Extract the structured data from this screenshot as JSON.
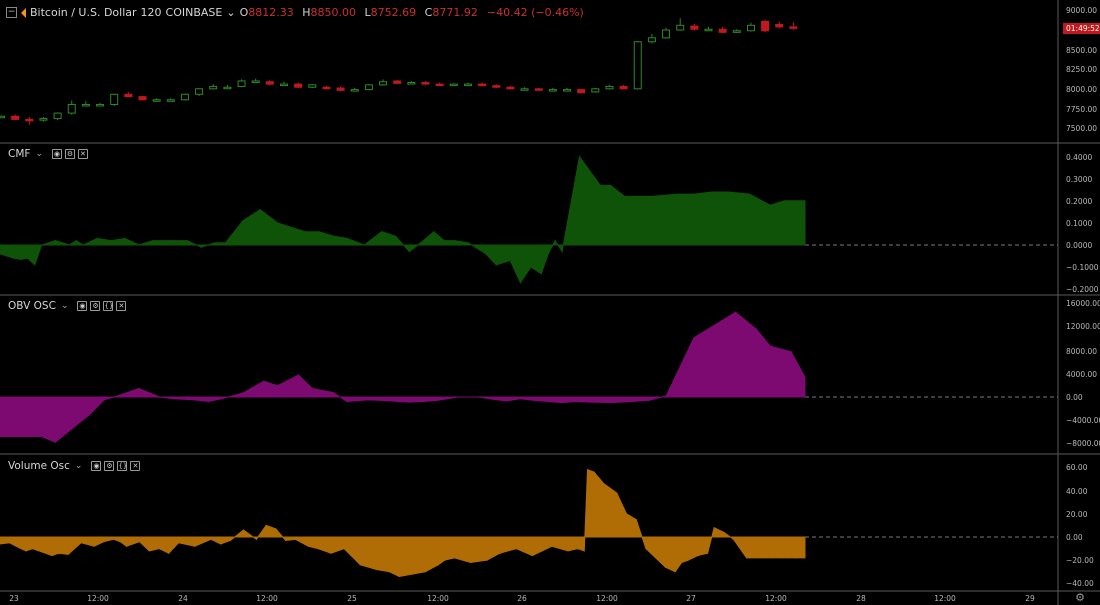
{
  "header": {
    "symbol": "Bitcoin / U.S. Dollar",
    "interval": "120",
    "exchange": "COINBASE",
    "o_label": "O",
    "o": "8812.33",
    "h_label": "H",
    "h": "8850.00",
    "l_label": "L",
    "l": "8752.69",
    "c_label": "C",
    "c": "8771.92",
    "change": "−40.42 (−0.46%)",
    "collapse_glyph": "−",
    "chevron": "⌄"
  },
  "colors": {
    "up": "#2d8a25",
    "down": "#c0181c",
    "cmf": "#0f5308",
    "obv": "#7d0a70",
    "vol": "#b06d05",
    "price_tag": "#c0181c"
  },
  "price_tag": "01:49:52",
  "x_ticks": [
    "23",
    "12:00",
    "24",
    "12:00",
    "25",
    "12:00",
    "26",
    "12:00",
    "27",
    "12:00",
    "28",
    "12:00",
    "29"
  ],
  "panes": {
    "price": {
      "ticks": [
        "9000.00",
        "8750.00",
        "8500.00",
        "8250.00",
        "8000.00",
        "7750.00",
        "7500.00"
      ]
    },
    "cmf": {
      "label": "CMF",
      "ticks": [
        "0.4000",
        "0.3000",
        "0.2000",
        "0.1000",
        "0.0000",
        "−0.1000",
        "−0.2000"
      ]
    },
    "obv": {
      "label": "OBV OSC",
      "ticks": [
        "16000.00",
        "12000.00",
        "8000.00",
        "4000.00",
        "0.00",
        "−4000.00",
        "−8000.00"
      ]
    },
    "vol": {
      "label": "Volume Osc",
      "ticks": [
        "60.00",
        "40.00",
        "20.00",
        "0.00",
        "−20.00",
        "−40.00"
      ]
    }
  },
  "chart_data": [
    {
      "type": "candlestick",
      "title": "Bitcoin / U.S. Dollar · 120 · COINBASE",
      "ylim": [
        7400,
        9100
      ],
      "x": [
        "23 00:00",
        "23 02:00",
        "23 04:00",
        "23 06:00",
        "23 08:00",
        "23 10:00",
        "23 12:00",
        "23 14:00",
        "23 16:00",
        "23 18:00",
        "23 20:00",
        "23 22:00",
        "24 00:00",
        "24 02:00",
        "24 04:00",
        "24 06:00",
        "24 08:00",
        "24 10:00",
        "24 12:00",
        "24 14:00",
        "24 16:00",
        "24 18:00",
        "24 20:00",
        "24 22:00",
        "25 00:00",
        "25 02:00",
        "25 04:00",
        "25 06:00",
        "25 08:00",
        "25 10:00",
        "25 12:00",
        "25 14:00",
        "25 16:00",
        "25 18:00",
        "25 20:00",
        "25 22:00",
        "26 00:00",
        "26 02:00",
        "26 04:00",
        "26 06:00",
        "26 08:00",
        "26 10:00",
        "26 12:00",
        "26 14:00",
        "26 16:00",
        "26 18:00",
        "26 20:00",
        "26 22:00",
        "27 00:00",
        "27 02:00",
        "27 04:00",
        "27 06:00",
        "27 08:00",
        "27 10:00",
        "27 12:00",
        "27 14:00",
        "27 16:00"
      ],
      "open": [
        7650,
        7650,
        7610,
        7600,
        7620,
        7690,
        7800,
        7800,
        7800,
        7930,
        7900,
        7860,
        7860,
        7860,
        7930,
        8000,
        8020,
        8030,
        8100,
        8090,
        8060,
        8060,
        8020,
        8020,
        8010,
        7980,
        7990,
        8050,
        8100,
        8070,
        8080,
        8060,
        8050,
        8060,
        8060,
        8040,
        8020,
        8000,
        8000,
        7990,
        7990,
        7990,
        7960,
        8000,
        8030,
        8000,
        8600,
        8650,
        8750,
        8800,
        8750,
        8760,
        8720,
        8740,
        8860,
        8820,
        8790
      ],
      "close": [
        7650,
        7610,
        7600,
        7620,
        7690,
        7800,
        7800,
        7800,
        7930,
        7900,
        7860,
        7860,
        7860,
        7930,
        8000,
        8030,
        8020,
        8100,
        8100,
        8060,
        8060,
        8020,
        8050,
        8010,
        7980,
        7990,
        8050,
        8090,
        8070,
        8080,
        8060,
        8050,
        8060,
        8060,
        8040,
        8020,
        8000,
        8000,
        7990,
        7990,
        7990,
        7950,
        8000,
        8030,
        8000,
        8600,
        8650,
        8750,
        8810,
        8760,
        8760,
        8720,
        8740,
        8810,
        8740,
        8790,
        8772
      ],
      "high": [
        7660,
        7670,
        7640,
        7640,
        7700,
        7850,
        7840,
        7820,
        7940,
        7960,
        7910,
        7880,
        7880,
        7940,
        8010,
        8060,
        8050,
        8120,
        8130,
        8110,
        8090,
        8080,
        8060,
        8040,
        8030,
        8010,
        8060,
        8120,
        8110,
        8100,
        8100,
        8080,
        8070,
        8080,
        8080,
        8060,
        8040,
        8020,
        8010,
        8010,
        8010,
        8000,
        8010,
        8050,
        8050,
        8610,
        8700,
        8780,
        8900,
        8830,
        8790,
        8790,
        8760,
        8840,
        8880,
        8860,
        8850
      ],
      "low": [
        7640,
        7600,
        7540,
        7580,
        7600,
        7670,
        7780,
        7780,
        7780,
        7890,
        7850,
        7840,
        7840,
        7850,
        7910,
        7990,
        8000,
        8020,
        8080,
        8040,
        8040,
        8010,
        8010,
        8000,
        7970,
        7970,
        7980,
        8040,
        8060,
        8060,
        8050,
        8040,
        8040,
        8050,
        8030,
        8010,
        7990,
        7990,
        7980,
        7980,
        7970,
        7940,
        7950,
        7990,
        7990,
        7990,
        8580,
        8640,
        8740,
        8740,
        8740,
        8710,
        8710,
        8730,
        8720,
        8770,
        8752
      ]
    },
    {
      "type": "area",
      "title": "CMF",
      "ylim": [
        -0.22,
        0.43
      ],
      "x": [
        0,
        4,
        6,
        8,
        10,
        12,
        16,
        20,
        22,
        24,
        28,
        32,
        36,
        40,
        44,
        50,
        54,
        58,
        62,
        65,
        70,
        75,
        80,
        84,
        88,
        92,
        96,
        100,
        105,
        110,
        114,
        118,
        122,
        125,
        128,
        131,
        135,
        140,
        143,
        147,
        150,
        153,
        156,
        158,
        160,
        162,
        167,
        173,
        176,
        180,
        188,
        195,
        200,
        205,
        210,
        216,
        222,
        226,
        230,
        232
      ],
      "values": [
        -0.04,
        -0.06,
        -0.065,
        -0.06,
        -0.09,
        0.0,
        0.02,
        0.0,
        0.02,
        0.0,
        0.03,
        0.02,
        0.03,
        0.0,
        0.02,
        0.02,
        0.02,
        -0.01,
        0.01,
        0.01,
        0.11,
        0.16,
        0.1,
        0.08,
        0.06,
        0.06,
        0.04,
        0.03,
        0.0,
        0.06,
        0.04,
        -0.03,
        0.02,
        0.06,
        0.02,
        0.02,
        0.01,
        -0.04,
        -0.09,
        -0.07,
        -0.17,
        -0.1,
        -0.13,
        -0.04,
        0.02,
        -0.03,
        0.4,
        0.27,
        0.27,
        0.22,
        0.22,
        0.23,
        0.23,
        0.24,
        0.24,
        0.23,
        0.18,
        0.2,
        0.2,
        0.2
      ]
    },
    {
      "type": "area",
      "title": "OBV OSC",
      "ylim": [
        -9000,
        16500
      ],
      "x": [
        0,
        12,
        16,
        20,
        26,
        30,
        34,
        40,
        46,
        50,
        56,
        60,
        64,
        70,
        76,
        80,
        86,
        90,
        96,
        100,
        106,
        110,
        118,
        122,
        126,
        132,
        138,
        142,
        146,
        150,
        154,
        158,
        162,
        166,
        170,
        176,
        182,
        187,
        192,
        200,
        212,
        218,
        222,
        228,
        232
      ],
      "values": [
        -7000,
        -7000,
        -8000,
        -6000,
        -3000,
        -500,
        200,
        1500,
        0,
        -300,
        -500,
        -800,
        -300,
        700,
        2800,
        2000,
        3900,
        1500,
        800,
        -800,
        -500,
        -600,
        -900,
        -800,
        -600,
        0,
        0,
        -400,
        -700,
        -300,
        -600,
        -800,
        -1000,
        -800,
        -900,
        -1000,
        -800,
        -600,
        200,
        10500,
        15000,
        12000,
        9000,
        8000,
        3500
      ]
    },
    {
      "type": "area",
      "title": "Volume Osc",
      "ylim": [
        -48,
        68
      ],
      "x": [
        0,
        6,
        10,
        16,
        20,
        26,
        32,
        36,
        42,
        50,
        58,
        64,
        70,
        74,
        78,
        86,
        92,
        98,
        104,
        110,
        120,
        130,
        136,
        142,
        150,
        158,
        164,
        170,
        176,
        182,
        190,
        196,
        204,
        212,
        222,
        232,
        240,
        246,
        254,
        262,
        270,
        274,
        280,
        290,
        300,
        308,
        318,
        328,
        340,
        350,
        356,
        360,
        362,
        366,
        372,
        380,
        386,
        392,
        398,
        404,
        410,
        416,
        420,
        424,
        430,
        436,
        440,
        446,
        452,
        460,
        466,
        470,
        476,
        482,
        486,
        490,
        496
      ],
      "values": [
        -6,
        -5,
        -8,
        -12,
        -10,
        -13,
        -16,
        -14,
        -15,
        -5,
        -8,
        -4,
        -2,
        -4,
        -8,
        -4,
        -12,
        -10,
        -14,
        -5,
        -8,
        -2,
        -6,
        -3,
        6,
        -2,
        10,
        7,
        -3,
        -2,
        -8,
        -10,
        -14,
        -10,
        -24,
        -28,
        -30,
        -34,
        -32,
        -30,
        -24,
        -20,
        -18,
        -22,
        -20,
        -14,
        -10,
        -16,
        -8,
        -12,
        -10,
        -12,
        58,
        56,
        46,
        38,
        20,
        15,
        -10,
        -18,
        -26,
        -30,
        -22,
        -20,
        -16,
        -14,
        8,
        4,
        -2,
        -18,
        -18,
        -18,
        -18,
        -18,
        -18,
        -18,
        -18
      ]
    }
  ]
}
